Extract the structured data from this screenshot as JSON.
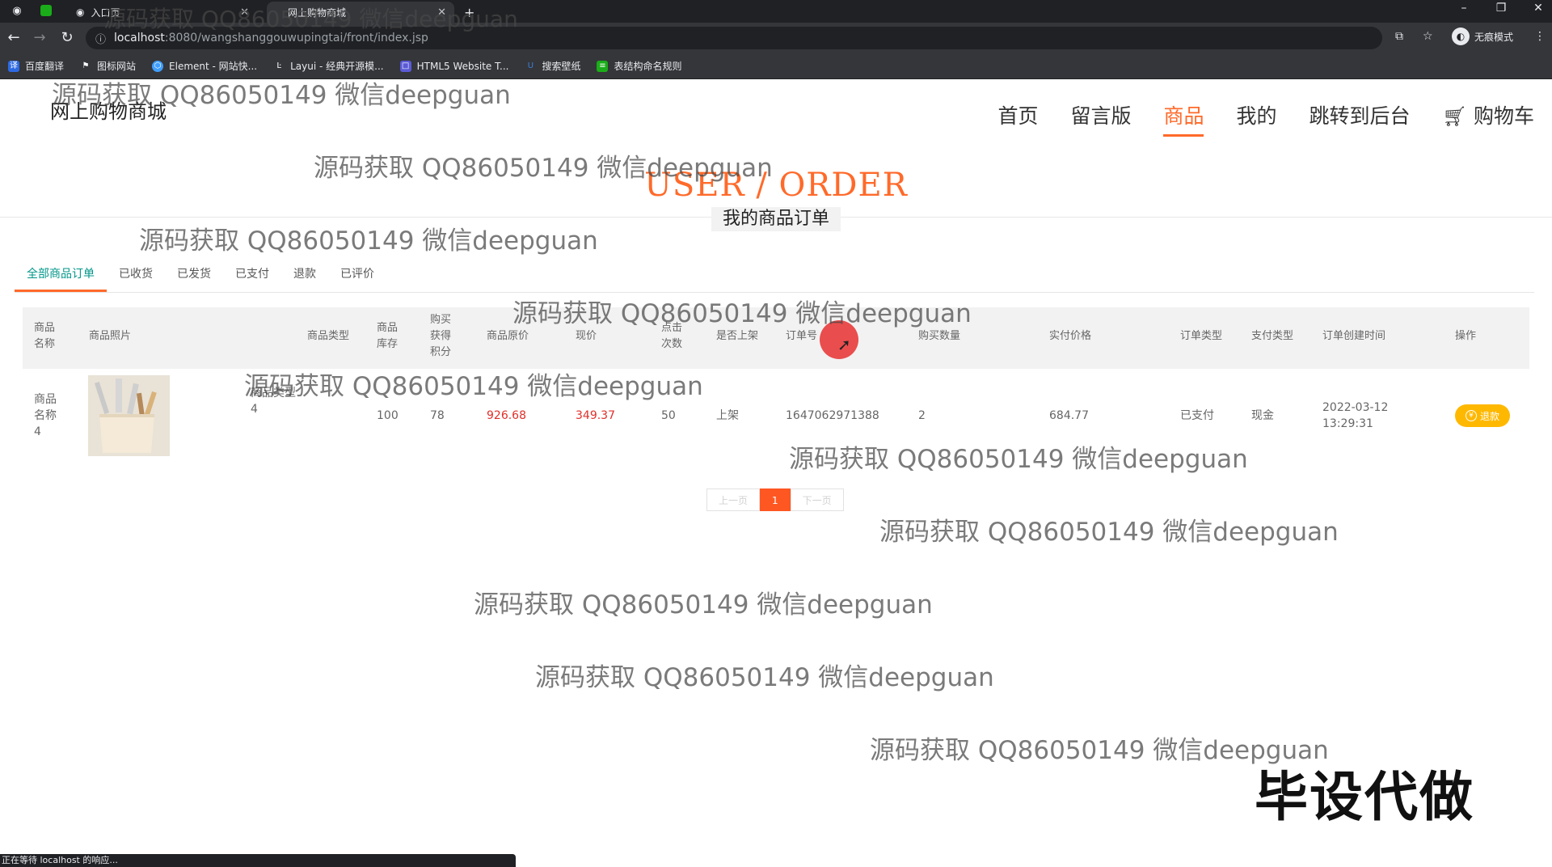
{
  "browser": {
    "tabs": [
      {
        "label": "入口页"
      },
      {
        "label": "网上购物商城"
      }
    ],
    "new_tab_symbol": "+",
    "url_host": "localhost",
    "url_path": ":8080/wangshanggouwupingtai/front/index.jsp",
    "incognito_label": "无痕模式",
    "bookmarks": [
      {
        "label": "百度翻译",
        "color": "#2d6ae3"
      },
      {
        "label": "图标网站",
        "color": "#ffffff"
      },
      {
        "label": "Element - 网站快...",
        "color": "#409eff"
      },
      {
        "label": "Layui - 经典开源模...",
        "color": "#ffffff"
      },
      {
        "label": "HTML5 Website T...",
        "color": "#5b5bd6"
      },
      {
        "label": "搜索壁纸",
        "color": "#3d7dd8"
      },
      {
        "label": "表结构命名规则",
        "color": "#1aad19"
      }
    ],
    "status_text": "正在等待 localhost 的响应..."
  },
  "site": {
    "title": "网上购物商城",
    "nav": [
      {
        "label": "首页"
      },
      {
        "label": "留言版"
      },
      {
        "label": "商品"
      },
      {
        "label": "我的"
      },
      {
        "label": "跳转到后台"
      },
      {
        "label": "购物车"
      }
    ],
    "accent": "#ff6a2a"
  },
  "order_page": {
    "heading": "USER / ORDER",
    "subheading": "我的商品订单",
    "tabs": [
      {
        "label": "全部商品订单"
      },
      {
        "label": "已收货"
      },
      {
        "label": "已发货"
      },
      {
        "label": "已支付"
      },
      {
        "label": "退款"
      },
      {
        "label": "已评价"
      }
    ],
    "columns": {
      "name": "商品名称",
      "photo": "商品照片",
      "type": "商品类型",
      "stock": "商品库存",
      "points": "购买获得积分",
      "orig_price": "商品原价",
      "price": "现价",
      "clicks": "点击次数",
      "on_shelf": "是否上架",
      "order_no": "订单号",
      "qty": "购买数量",
      "paid": "实付价格",
      "order_type": "订单类型",
      "pay_type": "支付类型",
      "created": "订单创建时间",
      "action": "操作"
    },
    "rows": [
      {
        "name": "商品名称4",
        "type": "商品类型4",
        "stock": "100",
        "points": "78",
        "orig_price": "926.68",
        "price": "349.37",
        "clicks": "50",
        "on_shelf": "上架",
        "order_no": "1647062971388",
        "qty": "2",
        "paid": "684.77",
        "order_type": "已支付",
        "pay_type": "现金",
        "created_date": "2022-03-12",
        "created_time": "13:29:31",
        "action_label": "退款"
      }
    ],
    "pager": {
      "prev": "上一页",
      "current": "1",
      "next": "下一页"
    }
  },
  "watermark": {
    "text": "源码获取 QQ86050149 微信deepguan",
    "stamp": "毕设代做"
  }
}
